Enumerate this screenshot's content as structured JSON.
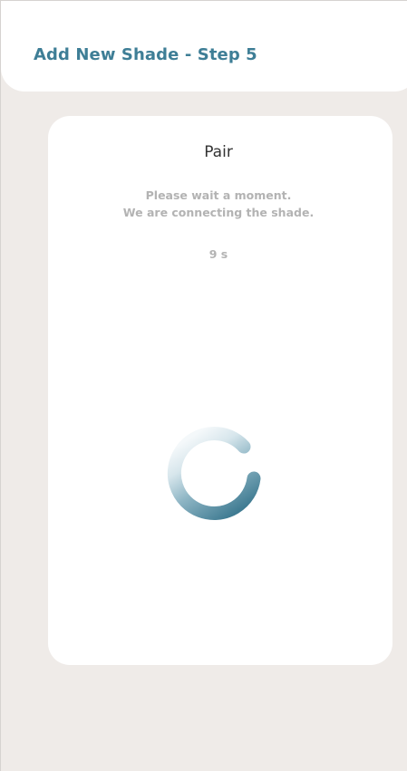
{
  "header": {
    "title": "Add New Shade - Step 5"
  },
  "pair_card": {
    "title": "Pair",
    "message_line1": "Please wait a moment.",
    "message_line2": "We are connecting the shade.",
    "countdown": "9 s",
    "spinner_icon": "loading-spinner-icon"
  },
  "colors": {
    "accent": "#3e7e96",
    "background": "#efebe8",
    "card": "#ffffff",
    "muted_text": "#b3b3b3"
  }
}
